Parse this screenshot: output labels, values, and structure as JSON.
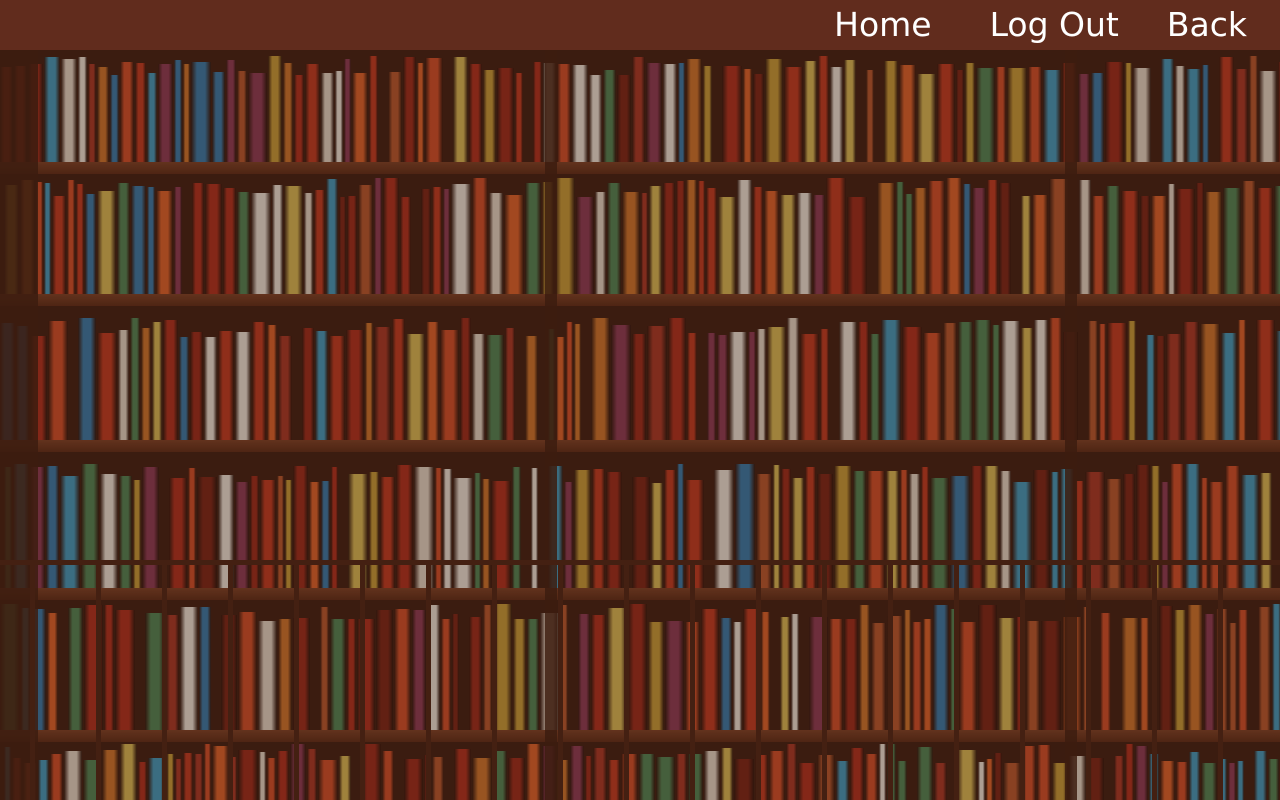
{
  "nav": {
    "home": "Home",
    "logout": "Log Out",
    "back": "Back"
  },
  "colors": {
    "header_bg": "#612c1d",
    "nav_text": "#ffffff",
    "shelf_wood": "#6b3820"
  },
  "background": {
    "description_icon": "bookshelf-image"
  }
}
